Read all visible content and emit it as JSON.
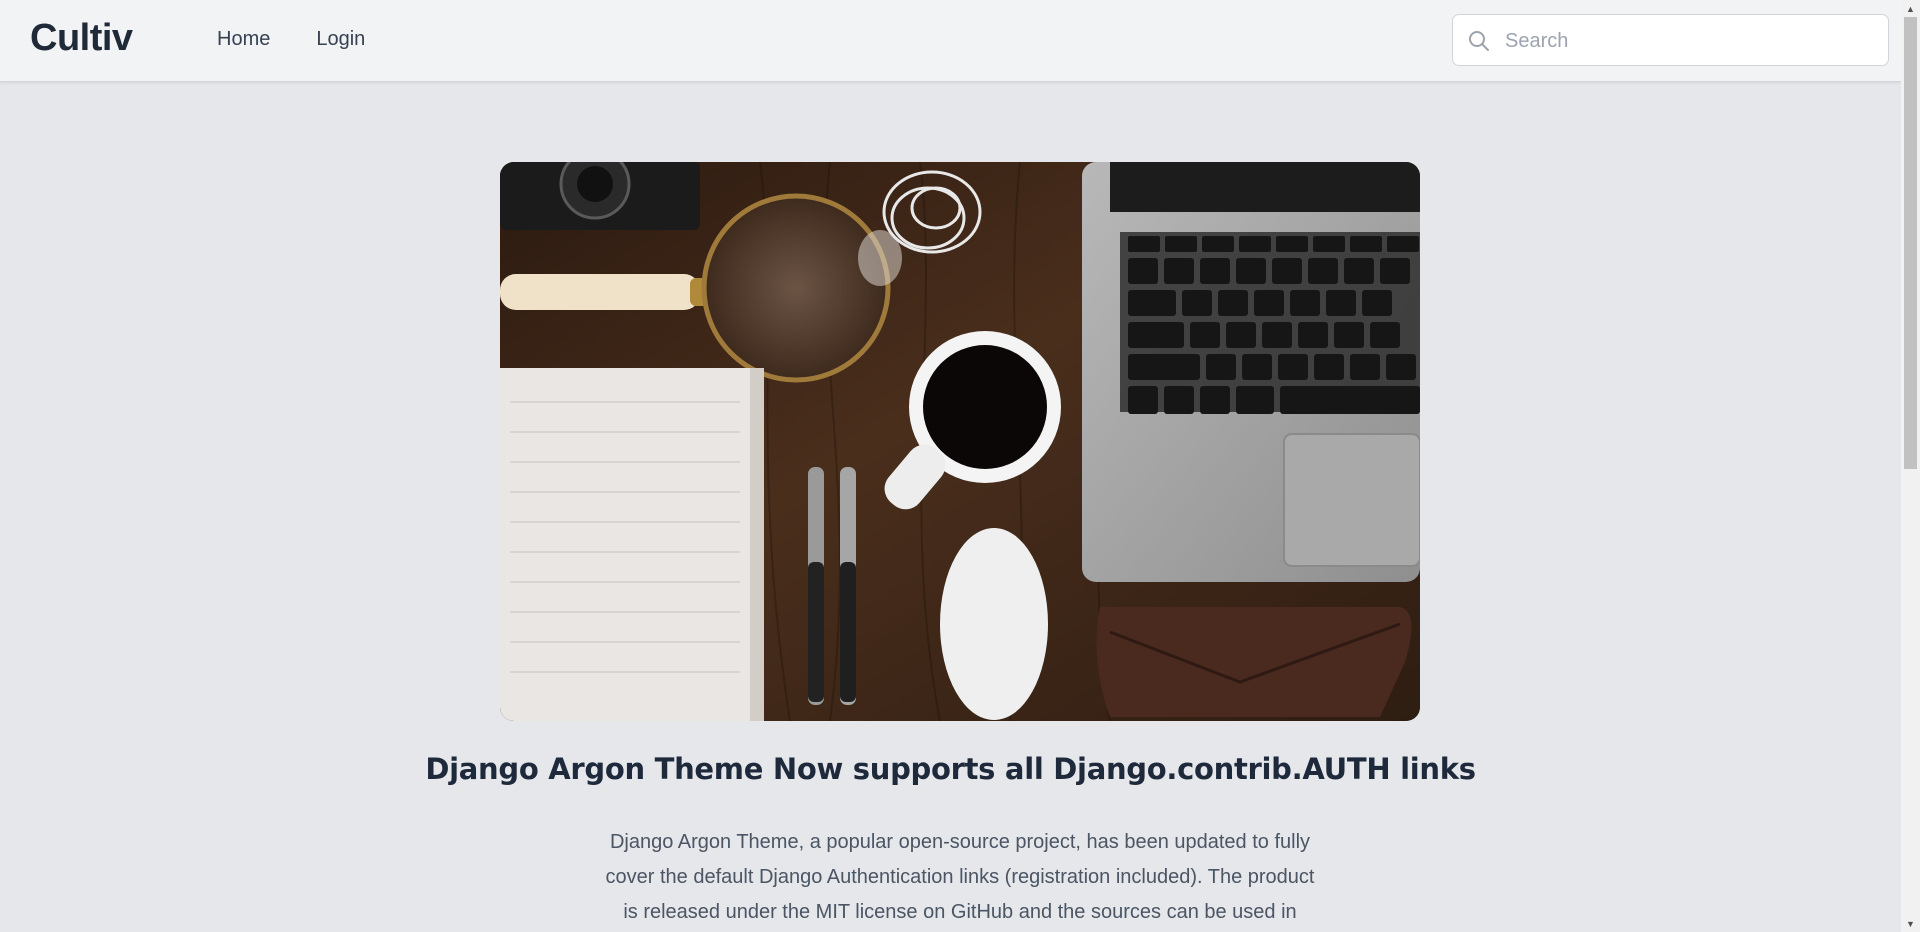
{
  "nav": {
    "brand": "Cultiv",
    "links": [
      "Home",
      "Login"
    ],
    "search": {
      "placeholder": "Search",
      "value": ""
    }
  },
  "article": {
    "image_alt": "Desk with laptop, coffee, notebook and mouse",
    "title": "Django Argon Theme Now supports all Django.contrib.AUTH links",
    "body": "Django Argon Theme, a popular open-source project, has been updated to fully cover the default Django Authentication links (registration included). The product is released under the MIT license on GitHub and the sources can be used in"
  },
  "colors": {
    "page_bg": "#e5e7eb",
    "navbar_bg": "#f2f3f5",
    "heading": "#1e293b",
    "body_text": "#4b5563"
  }
}
